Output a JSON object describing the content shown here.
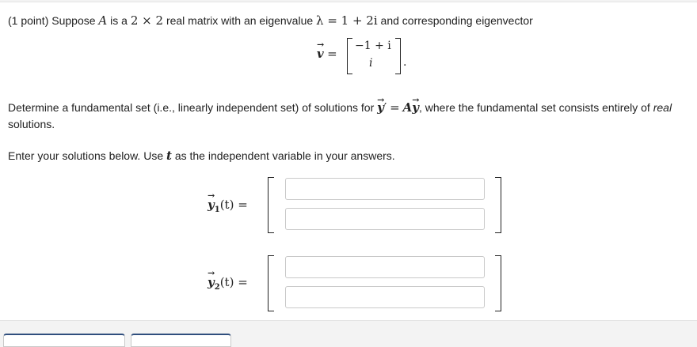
{
  "problem": {
    "points": "(1 point)",
    "intro_a": "Suppose",
    "matrix_var": "A",
    "intro_b": "is a",
    "size_expr": "2 × 2",
    "intro_c": "real matrix with an eigenvalue",
    "eigenvalue_expr": "λ = 1 + 2i",
    "intro_d": "and corresponding eigenvector",
    "eigenvector_label": "v",
    "eigenvector": [
      "−1 + i",
      "i"
    ],
    "eq_sign": "=",
    "period": ".",
    "determine_a": "Determine a fundamental set (i.e., linearly independent set) of solutions for",
    "ode_lhs": "y",
    "ode_prime": "′",
    "ode_eq": "=",
    "ode_rhs_a": "A",
    "ode_rhs_y": "y",
    "determine_b": ", where the fundamental set consists entirely of",
    "real_word": "real",
    "determine_c": "solutions.",
    "enter_a": "Enter your solutions below. Use",
    "t_var": "t",
    "enter_b": "as the independent variable in your answers."
  },
  "answers": [
    {
      "label_y": "y",
      "label_sub": "1",
      "label_arg": "(t) =",
      "inputs": [
        "",
        ""
      ]
    },
    {
      "label_y": "y",
      "label_sub": "2",
      "label_arg": "(t) =",
      "inputs": [
        "",
        ""
      ]
    }
  ]
}
